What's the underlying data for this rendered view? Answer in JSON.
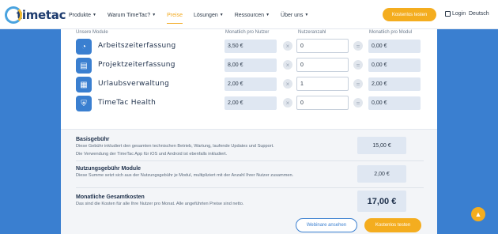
{
  "header": {
    "logo_text": "timetac",
    "nav": [
      {
        "label": "Produkte",
        "active": false
      },
      {
        "label": "Warum TimeTac?",
        "active": false
      },
      {
        "label": "Preise",
        "active": true
      },
      {
        "label": "Lösungen",
        "active": false
      },
      {
        "label": "Ressourcen",
        "active": false
      },
      {
        "label": "Über uns",
        "active": false
      }
    ],
    "cta_label": "Kostenlos testen",
    "login_label": "Login",
    "language_label": "Deutsch"
  },
  "table": {
    "headers": {
      "modules": "Unsere Module",
      "monthly_price": "Monatlich pro Nutzer",
      "user_count": "Nutzeranzahl",
      "monthly_module": "Monatlich pro Modul"
    },
    "modules": [
      {
        "name": "Arbeitszeiterfassung",
        "price": "3,50 €",
        "qty": "0",
        "total": "0,00 €",
        "icon": "clock-icon"
      },
      {
        "name": "Projektzeiterfassung",
        "price": "8,00 €",
        "qty": "0",
        "total": "0,00 €",
        "icon": "folder-icon"
      },
      {
        "name": "Urlaubsverwaltung",
        "price": "2,00 €",
        "qty": "1",
        "total": "2,00 €",
        "icon": "calendar-icon"
      },
      {
        "name": "TimeTac Health",
        "price": "2,00 €",
        "qty": "0",
        "total": "0,00 €",
        "icon": "shield-icon"
      }
    ]
  },
  "summary": {
    "base_fee": {
      "title": "Basisgebühr",
      "desc1": "Diese Gebühr inkludiert den gesamten technischen Betrieb, Wartung, laufende Updates und Support.",
      "desc2": "Die Verwendung der TimeTac App für iOS und Android ist ebenfalls inkludiert.",
      "value": "15,00 €"
    },
    "usage_fee": {
      "title": "Nutzungsgebühr Module",
      "desc1": "Diese Summe setzt sich aus der Nutzungsgebühr je Modul, multipliziert mit der Anzahl Ihrer Nutzer zusammen.",
      "value": "2,00 €"
    },
    "total": {
      "title": "Monatliche Gesamtkosten",
      "desc1": "Das sind die Kosten für alle Ihre Nutzer pro Monat. Alle angeführten Preise sind netto.",
      "value": "17,00 €"
    }
  },
  "buttons": {
    "webinar": "Webinare ansehen",
    "trial": "Kostenlos testen"
  },
  "colors": {
    "brand_blue": "#3a7fd0",
    "accent_orange": "#f4ad1f"
  }
}
